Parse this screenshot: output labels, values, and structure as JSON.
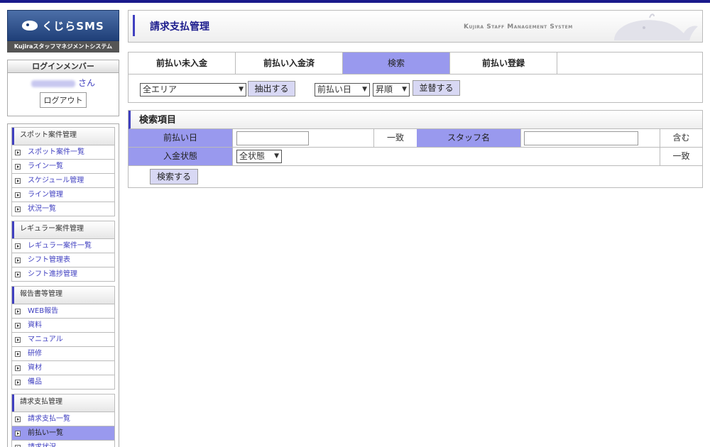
{
  "sidebar": {
    "logo_text": "くじらSMS",
    "logo_sub": "Kujiraスタッフマネジメントシステム",
    "login": {
      "heading": "ログインメンバー",
      "suffix": "さん",
      "logout_label": "ログアウト"
    },
    "groups": [
      {
        "title": "スポット案件管理",
        "items": [
          "スポット案件一覧",
          "ライン一覧",
          "スケジュール管理",
          "ライン管理",
          "状況一覧"
        ]
      },
      {
        "title": "レギュラー案件管理",
        "items": [
          "レギュラー案件一覧",
          "シフト管理表",
          "シフト進捗管理"
        ]
      },
      {
        "title": "報告書等管理",
        "items": [
          "WEB報告",
          "資料",
          "マニュアル",
          "研修",
          "資材",
          "備品"
        ]
      },
      {
        "title": "請求支払管理",
        "items": [
          "請求支払一覧",
          "前払い一覧",
          "請求状況"
        ]
      }
    ],
    "active_item": "前払い一覧"
  },
  "header": {
    "title": "請求支払管理",
    "brand": "Kujira Staff Management System"
  },
  "tabs": [
    {
      "label": "前払い未入金"
    },
    {
      "label": "前払い入金済"
    },
    {
      "label": "検索"
    },
    {
      "label": "前払い登録"
    }
  ],
  "active_tab": "検索",
  "filter": {
    "area_value": "全エリア",
    "extract_label": "抽出する",
    "sort_field_value": "前払い日",
    "sort_order_value": "昇順",
    "sort_label": "並替する"
  },
  "search": {
    "heading": "検索項目",
    "field1_label": "前払い日",
    "field1_value": "",
    "field1_mode": "一致",
    "field2_label": "スタッフ名",
    "field2_value": "",
    "field2_mode": "含む",
    "field3_label": "入金状態",
    "field3_value": "全状態",
    "field3_mode": "一致",
    "submit_label": "検索する"
  },
  "colors": {
    "accent": "#9999ee",
    "nav_text": "#4040c0",
    "title_text": "#1a1a8c"
  }
}
